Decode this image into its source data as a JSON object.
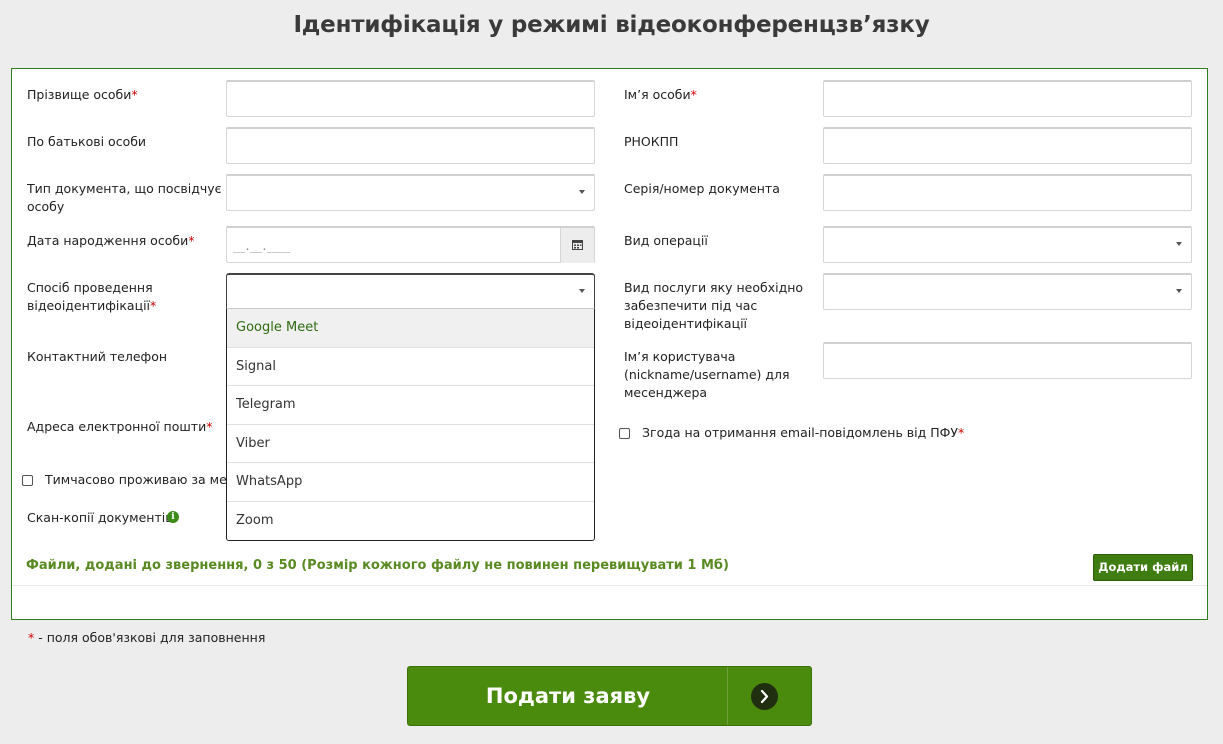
{
  "page": {
    "title": "Ідентифікація у режимі відеоконференцзв’язку"
  },
  "fields": {
    "surname_label": "Прізвище особи",
    "name_label": "Ім’я особи",
    "patronymic_label": "По батькові особи",
    "rnokpp_label": "РНОКПП",
    "doc_type_label_1": "Тип документа, що посвідчує",
    "doc_type_label_2": "особу",
    "doc_number_label": "Серія/номер документа",
    "birth_date_label": "Дата народження особи",
    "birth_date_mask": "__.__.____",
    "operation_label": "Вид операції",
    "method_label_1": "Спосіб проведення",
    "method_label_2": "відеоідентифікації",
    "service_label_1": "Вид послуги яку необхідно",
    "service_label_2": "забезпечити під час",
    "service_label_3": "відеоідентифікації",
    "phone_label": "Контактний телефон",
    "username_label_1": "Ім’я користувача",
    "username_label_2": "(nickname/username) для",
    "username_label_3": "месенджера",
    "email_label": "Адреса електронної пошти",
    "consent_label": "Згода на отримання email-повідомлень від ПФУ",
    "temp_resident_label": "Тимчасово проживаю за межа",
    "scans_label": "Скан-копії документів",
    "required_mark": "*"
  },
  "dropdown": {
    "options": [
      "Google Meet",
      "Signal",
      "Telegram",
      "Viber",
      "WhatsApp",
      "Zoom"
    ],
    "highlighted": "Google Meet"
  },
  "files": {
    "status_text": "Файли, додані до звернення, 0 з 50 (Розмір кожного файлу не повинен перевищувати 1 Мб)",
    "add_button": "Додати файл"
  },
  "footer": {
    "required_note": " - поля обов'язкові для заповнення",
    "submit_label": "Подати заяву"
  },
  "colors": {
    "accent": "#4a8a0c",
    "border": "#2f7d1d",
    "required": "#d00000"
  }
}
